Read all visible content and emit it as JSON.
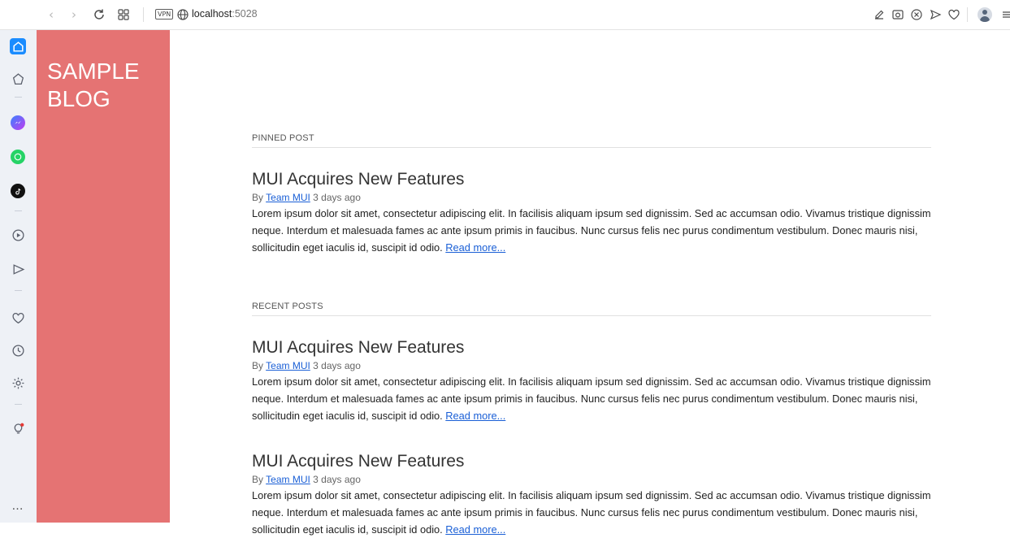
{
  "browser": {
    "url_host": "localhost",
    "url_port": ":5028",
    "vpn_label": "VPN"
  },
  "blog": {
    "title_line1": "SAMPLE",
    "title_line2": "BLOG"
  },
  "pinned": {
    "heading": "PINNED POST",
    "post": {
      "title": "MUI Acquires New Features",
      "by": "By",
      "author": "Team MUI",
      "time": "3 days ago",
      "body": "Lorem ipsum dolor sit amet, consectetur adipiscing elit. In facilisis aliquam ipsum sed dignissim. Sed ac accumsan odio. Vivamus tristique dignissim neque. Interdum et malesuada fames ac ante ipsum primis in faucibus. Nunc cursus felis nec purus condimentum vestibulum. Donec mauris nisi, sollicitudin eget iaculis id, suscipit id odio.",
      "read_more": "Read more..."
    }
  },
  "recent": {
    "heading": "RECENT POSTS",
    "posts": [
      {
        "title": "MUI Acquires New Features",
        "by": "By",
        "author": "Team MUI",
        "time": "3 days ago",
        "body": "Lorem ipsum dolor sit amet, consectetur adipiscing elit. In facilisis aliquam ipsum sed dignissim. Sed ac accumsan odio. Vivamus tristique dignissim neque. Interdum et malesuada fames ac ante ipsum primis in faucibus. Nunc cursus felis nec purus condimentum vestibulum. Donec mauris nisi, sollicitudin eget iaculis id, suscipit id odio.",
        "read_more": "Read more..."
      },
      {
        "title": "MUI Acquires New Features",
        "by": "By",
        "author": "Team MUI",
        "time": "3 days ago",
        "body": "Lorem ipsum dolor sit amet, consectetur adipiscing elit. In facilisis aliquam ipsum sed dignissim. Sed ac accumsan odio. Vivamus tristique dignissim neque. Interdum et malesuada fames ac ante ipsum primis in faucibus. Nunc cursus felis nec purus condimentum vestibulum. Donec mauris nisi, sollicitudin eget iaculis id, suscipit id odio.",
        "read_more": "Read more..."
      }
    ]
  },
  "colors": {
    "panel": "#e57373",
    "accent": "#1a8cff",
    "link": "#1a5fd6"
  },
  "icons": {
    "toolbar": [
      "back-icon",
      "forward-icon",
      "reload-icon",
      "tabs-grid-icon",
      "vpn-icon",
      "globe-icon",
      "edit-icon",
      "camera-icon",
      "block-icon",
      "send-icon",
      "heart-icon",
      "profile-icon",
      "menu-icon"
    ],
    "sidebar": [
      "home-icon",
      "speed-dial-icon",
      "messenger-icon",
      "whatsapp-icon",
      "tiktok-icon",
      "player-icon",
      "flow-icon",
      "pinboard-icon",
      "history-icon",
      "settings-icon",
      "tips-icon",
      "more-icon"
    ]
  }
}
